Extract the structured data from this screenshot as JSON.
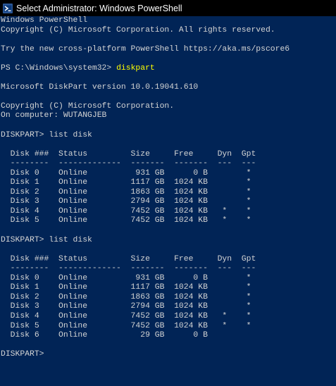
{
  "window": {
    "title": "Select Administrator: Windows PowerShell",
    "icon": "powershell-icon",
    "background": "#012456",
    "text_color": "#d4d4d4",
    "command_color": "#ffff00"
  },
  "console": {
    "lines": [
      {
        "text": "Windows PowerShell"
      },
      {
        "text": "Copyright (C) Microsoft Corporation. All rights reserved."
      },
      {
        "text": ""
      },
      {
        "text": "Try the new cross-platform PowerShell https://aka.ms/pscore6"
      },
      {
        "text": ""
      },
      {
        "prompt": "PS C:\\Windows\\system32> ",
        "command": "diskpart"
      },
      {
        "text": ""
      },
      {
        "text": "Microsoft DiskPart version 10.0.19041.610"
      },
      {
        "text": ""
      },
      {
        "text": "Copyright (C) Microsoft Corporation."
      },
      {
        "text": "On computer: WUTANGJEB"
      },
      {
        "text": ""
      },
      {
        "text": "DISKPART> list disk"
      },
      {
        "text": ""
      },
      {
        "text": "  Disk ###  Status         Size     Free     Dyn  Gpt"
      },
      {
        "text": "  --------  -------------  -------  -------  ---  ---"
      },
      {
        "text": "  Disk 0    Online          931 GB      0 B        *"
      },
      {
        "text": "  Disk 1    Online         1117 GB  1024 KB        *"
      },
      {
        "text": "  Disk 2    Online         1863 GB  1024 KB        *"
      },
      {
        "text": "  Disk 3    Online         2794 GB  1024 KB        *"
      },
      {
        "text": "  Disk 4    Online         7452 GB  1024 KB   *    *"
      },
      {
        "text": "  Disk 5    Online         7452 GB  1024 KB   *    *"
      },
      {
        "text": ""
      },
      {
        "text": "DISKPART> list disk"
      },
      {
        "text": ""
      },
      {
        "text": "  Disk ###  Status         Size     Free     Dyn  Gpt"
      },
      {
        "text": "  --------  -------------  -------  -------  ---  ---"
      },
      {
        "text": "  Disk 0    Online          931 GB      0 B        *"
      },
      {
        "text": "  Disk 1    Online         1117 GB  1024 KB        *"
      },
      {
        "text": "  Disk 2    Online         1863 GB  1024 KB        *"
      },
      {
        "text": "  Disk 3    Online         2794 GB  1024 KB        *"
      },
      {
        "text": "  Disk 4    Online         7452 GB  1024 KB   *    *"
      },
      {
        "text": "  Disk 5    Online         7452 GB  1024 KB   *    *"
      },
      {
        "text": "  Disk 6    Online           29 GB      0 B"
      },
      {
        "text": ""
      },
      {
        "text": "DISKPART>"
      }
    ]
  }
}
